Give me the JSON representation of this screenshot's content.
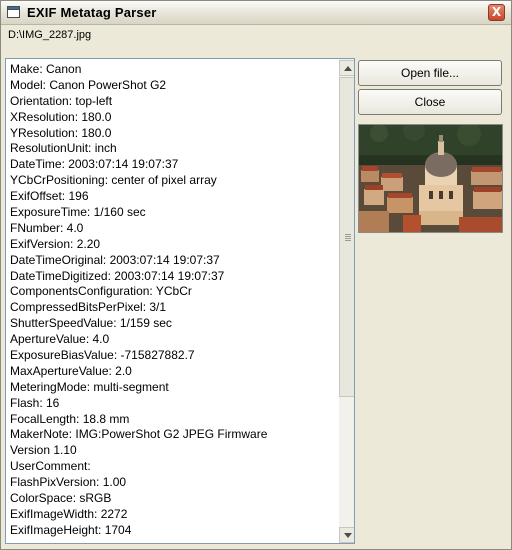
{
  "window": {
    "title": "EXIF Metatag Parser",
    "close_glyph": "X",
    "icon": "app-window-icon"
  },
  "file_path": "D:\\IMG_2287.jpg",
  "exif_lines": [
    "Make: Canon",
    "Model: Canon PowerShot G2",
    "Orientation: top-left",
    "XResolution: 180.0",
    "YResolution: 180.0",
    "ResolutionUnit: inch",
    "DateTime: 2003:07:14 19:07:37",
    "YCbCrPositioning: center of pixel array",
    "ExifOffset: 196",
    "ExposureTime: 1/160 sec",
    "FNumber: 4.0",
    "ExifVersion: 2.20",
    "DateTimeOriginal: 2003:07:14 19:07:37",
    "DateTimeDigitized: 2003:07:14 19:07:37",
    "ComponentsConfiguration: YCbCr",
    "CompressedBitsPerPixel: 3/1",
    "ShutterSpeedValue: 1/159 sec",
    "ApertureValue: 4.0",
    "ExposureBiasValue: -715827882.7",
    "MaxApertureValue: 2.0",
    "MeteringMode: multi-segment",
    "Flash: 16",
    "FocalLength: 18.8 mm",
    "MakerNote: IMG:PowerShot G2 JPEG Firmware",
    "Version 1.10",
    "UserComment:",
    "FlashPixVersion: 1.00",
    "ColorSpace: sRGB",
    "ExifImageWidth: 2272",
    "ExifImageHeight: 1704"
  ],
  "buttons": {
    "open": "Open file...",
    "close": "Close"
  },
  "colors": {
    "title_bar": "#e6e3d6",
    "close_button": "#c9462c",
    "listbox_border": "#7f9db9",
    "dialog_face": "#ece9d8"
  }
}
